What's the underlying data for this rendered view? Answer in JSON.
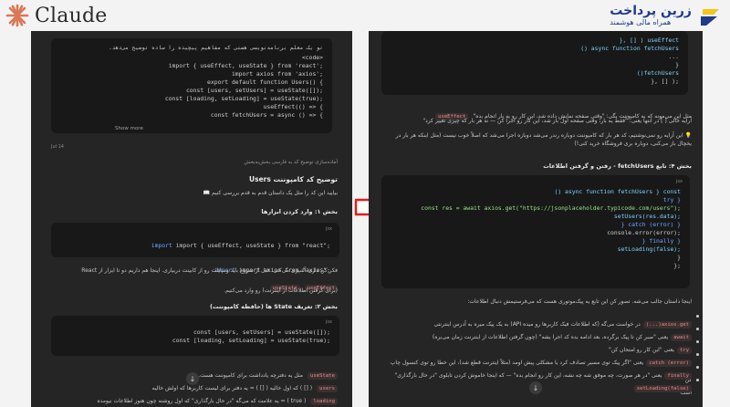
{
  "brand_left": {
    "name": "Claude"
  },
  "brand_right": {
    "title": "زرین پرداخت",
    "subtitle": "همراه مالی هوشمند"
  },
  "left": {
    "prompt_intro": "تو یک معلم برنامه‌نویسی هستی که مفاهیم پیچیده را ساده توضیح می‌دهد.",
    "prompt_code": [
      "<code>",
      "import { useEffect, useState } from 'react';",
      "import axios from 'axios';",
      "export default function Users() {",
      "  const [users, setUsers] = useState([]);",
      "  const [loading, setLoading] = useState(true);",
      "  useEffect(() => {",
      "    const fetchUsers = async () => {"
    ],
    "show_more": "Show more",
    "date": "Jul 14",
    "request_note": "آماده‌سازی توضیح کد به فارسی بخش‌به‌بخش",
    "title": "توضیح کد کامپوننت Users",
    "intro": "بیایید این کد را مثل یک داستان قدم به قدم بررسی کنیم 📖",
    "s1_title": "بخش ۱: وارد کردن ابزارها",
    "s1_code": [
      "import { useEffect, useState } from \"react\";",
      "import axios from \"axios\";"
    ],
    "s1_desc_1": "فکر کن داری آشپزی می‌کنی. قبل از شروع باید وسایلت رو از کابینت دربیاری. اینجا هم داریم دو تا ابزار از React",
    "s1_desc_2": "(برای گرفتن اطلاعات از اینترنت) رو وارد می‌کنیم.",
    "s1_pill_1": "useEffect",
    "s1_pill_2": "useState",
    "s1_pill_3": "axios",
    "s2_title": "بخش ۲: تعریف State ها (حافظه کامپوننت)",
    "s2_code": [
      "const [users, setUsers] = useState([]);",
      "const [loading, setLoading] = useState(true);"
    ],
    "s2_desc": "مثل یه دفترچه یادداشت برای کامپوننت هست.",
    "s2_item_1": "( [] ) که اول خالیه ( [] ) = یه دفتر برای لیست کاربرها که اولش خالیه",
    "s2_item_2": "( true ) = یه علامت که می‌گه \"در حال بارگذاری\" که اول روشنه چون هنوز اطلاعات نیومده",
    "s2_pill_1": "useState",
    "s2_pill_2": "users",
    "s2_pill_3": "loading",
    "lang": "jsx"
  },
  "right": {
    "top_code": [
      "    }, [] ) useEffect",
      "      () async function fetchUsers",
      "        ...",
      "      }",
      "      ()fetchUsers",
      "    }, [] );"
    ],
    "intro_1": "مثل این می‌مونه که به کامپوننت بگی: \"وقتی صفحه نمایش داده شد، این کار رو یه بار انجام بده\"",
    "intro_pill": "useEffect",
    "intro_2": "آرایه خالی [ ] در انتها یعنی: \"فقط یه بار، وقتی صفحه اول باز شد، این کار رو اجرا کن — نه هر بار که چیزی تغییر کرد\"",
    "intro_3": "💡 این آرایه رو نمی‌نوشتیم، کد هر بار که کامپوننت دوباره رندر می‌شد دوباره اجرا می‌شد که اصلاً خوب نیست (مثل اینکه هر بار در یخچال باز می‌کنی، دوباره بری فروشگاه خرید کنی!)",
    "s4_title": "بخش ۴: تابع fetchUsers - رفتن و گرفتن اطلاعات",
    "s4_code": [
      "    () async function fetchUsers } const",
      "      try }",
      "        const res = await axios.get(\"https://jsonplaceholder.typicode.com/users\");",
      "        setUsers(res.data);",
      "      } catch (error) }",
      "        console.error(error);",
      "      } finally }",
      "        setLoading(false);",
      "      }",
      "    };"
    ],
    "lang": "jsx",
    "summary": "اینجا داستان جالب می‌شه. تصور کن این تابع یه پیک‌موتوری هست که می‌فرستیمش دنبال اطلاعات:",
    "bullets": [
      {
        "pill": "axios.get(...)",
        "text": "در خواست می‌گه (که اطلاعات فیک کاربرها رو میده API) به یک پیک میره به آدرس اینترنتی"
      },
      {
        "pill": "await",
        "text": "یعنی \"صبر کن تا پیک برگرده، بعد ادامه بده کد اجرا بشه\" (چون گرفتن اطلاعات از اینترنت زمان می‌بره)"
      },
      {
        "pill": "try",
        "text": "یعنی \"این کار رو امتحان کن\""
      },
      {
        "pill": "catch (error)",
        "text": "یعنی \"اگر پیک توی مسیر تصادف کرد یا مشکلی پیش اومد (مثلاً اینترنت قطع شد)، این خطا رو توی کنسول چاپ کن\""
      },
      {
        "pill": "finally",
        "text": "یعنی \"در هر صورت، چه موفق شه چه نشه، این کار رو انجام بده\" — که اینجا خاموش کردن تابلوی \"در حال بارگذاری\" است"
      },
      {
        "pill": "setLoading(false)",
        "text": ""
      }
    ],
    "url": "https://jsonplaceholder.typicode.com/users"
  }
}
